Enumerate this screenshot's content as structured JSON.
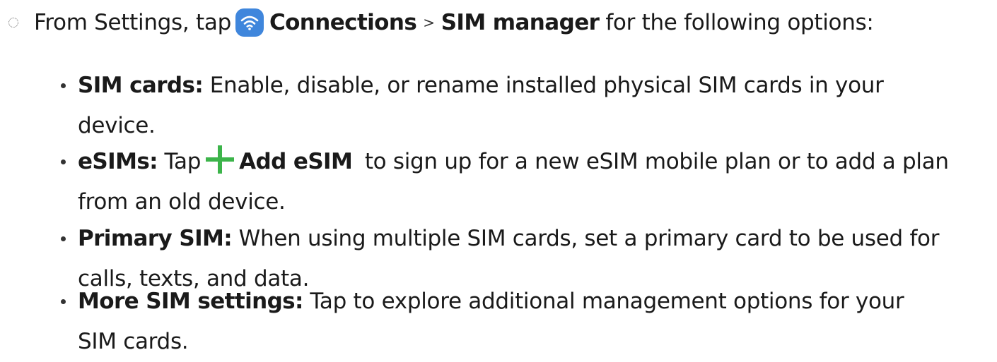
{
  "step": {
    "prefix": "From Settings, tap",
    "connections": "Connections",
    "separator": ">",
    "sim_manager": "SIM manager",
    "suffix": "for the following options:"
  },
  "options": [
    {
      "term": "SIM cards:",
      "text": "Enable, disable, or rename installed physical SIM cards in your",
      "text_cont": "device."
    },
    {
      "term": "eSIMs:",
      "pre": "Tap",
      "action": "Add eSIM",
      "text": "to sign up for a new eSIM mobile plan or to add a plan",
      "text_cont": "from an old device."
    },
    {
      "term": "Primary SIM:",
      "text": "When using multiple SIM cards, set a primary card to be used for",
      "text_cont": "calls, texts, and data."
    },
    {
      "term": "More SIM settings:",
      "text": "Tap to explore additional management options for your",
      "text_cont": "SIM cards."
    }
  ],
  "icons": {
    "connections": "wifi-icon",
    "add": "plus-icon"
  },
  "colors": {
    "text": "#1a1a1a",
    "wifi_badge": "#3f86dc",
    "plus": "#3cb44a"
  }
}
